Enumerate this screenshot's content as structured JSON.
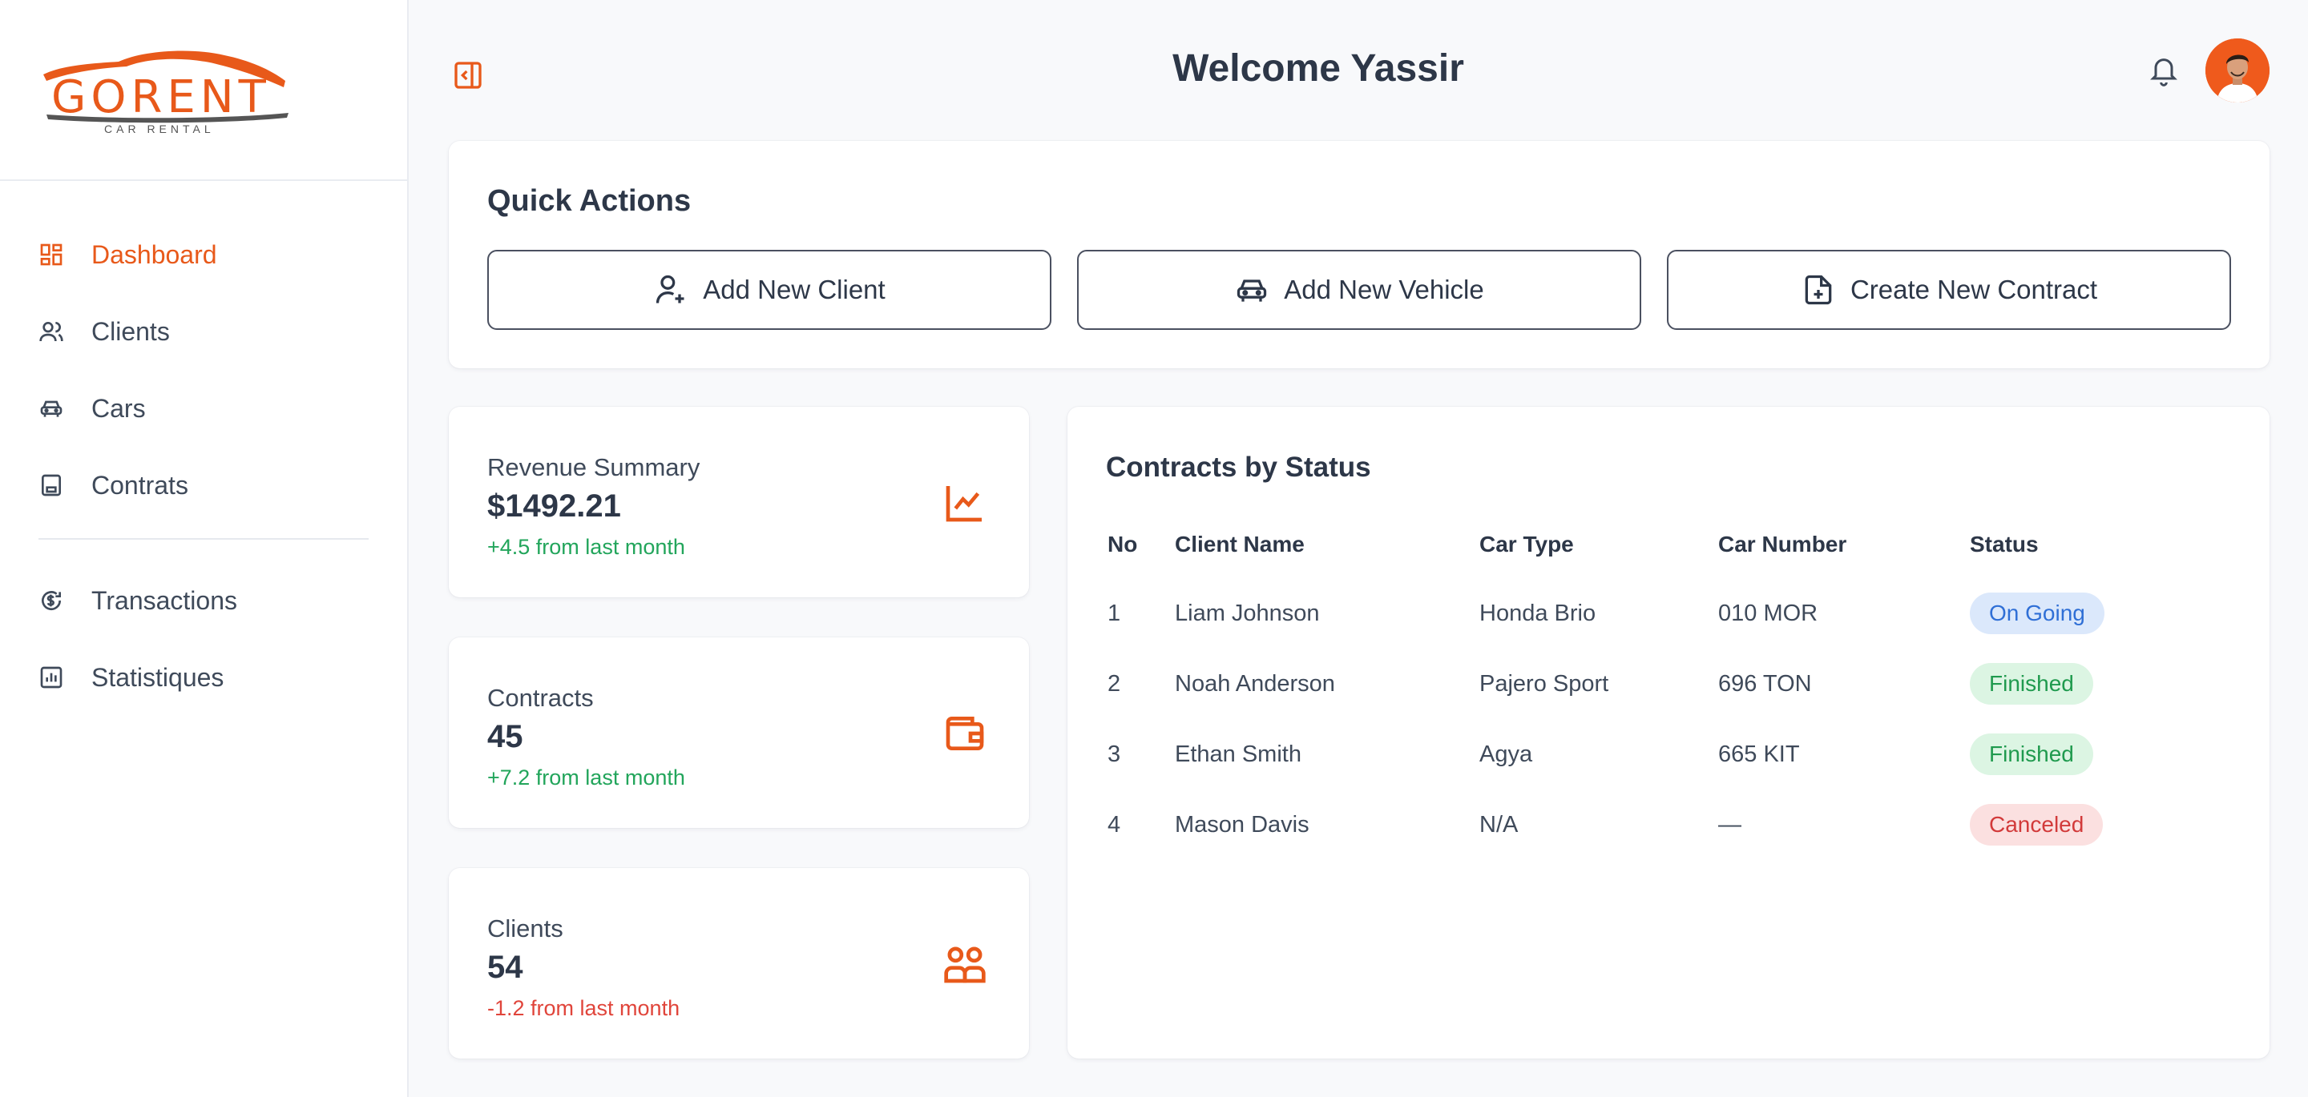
{
  "brand": {
    "name": "GORENT",
    "tagline": "CAR RENTAL"
  },
  "sidebar": {
    "items": [
      {
        "label": "Dashboard",
        "icon": "dashboard-icon",
        "active": true
      },
      {
        "label": "Clients",
        "icon": "users-icon",
        "active": false
      },
      {
        "label": "Cars",
        "icon": "car-icon",
        "active": false
      },
      {
        "label": "Contrats",
        "icon": "contract-icon",
        "active": false
      }
    ],
    "secondary": [
      {
        "label": "Transactions",
        "icon": "transactions-icon"
      },
      {
        "label": "Statistiques",
        "icon": "chart-bar-icon"
      }
    ]
  },
  "header": {
    "welcome": "Welcome Yassir"
  },
  "quick_actions": {
    "title": "Quick Actions",
    "buttons": [
      {
        "label": "Add New Client",
        "icon": "user-plus-icon"
      },
      {
        "label": "Add New Vehicle",
        "icon": "car-icon"
      },
      {
        "label": "Create New Contract",
        "icon": "file-plus-icon"
      }
    ]
  },
  "stats": [
    {
      "label": "Revenue Summary",
      "value": "$1492.21",
      "delta": "+4.5 from last month",
      "trend": "up",
      "icon": "trend-up-icon"
    },
    {
      "label": "Contracts",
      "value": "45",
      "delta": "+7.2 from last month",
      "trend": "up",
      "icon": "wallet-icon"
    },
    {
      "label": "Clients",
      "value": "54",
      "delta": "-1.2 from last month",
      "trend": "down",
      "icon": "group-icon"
    }
  ],
  "contracts_table": {
    "title": "Contracts by Status",
    "columns": [
      "No",
      "Client Name",
      "Car Type",
      "Car Number",
      "Status"
    ],
    "rows": [
      {
        "no": "1",
        "client": "Liam Johnson",
        "car_type": "Honda Brio",
        "car_number": "010 MOR",
        "status": "On Going"
      },
      {
        "no": "2",
        "client": "Noah Anderson",
        "car_type": "Pajero Sport",
        "car_number": "696 TON",
        "status": "Finished"
      },
      {
        "no": "3",
        "client": "Ethan Smith",
        "car_type": "Agya",
        "car_number": "665 KIT",
        "status": "Finished"
      },
      {
        "no": "4",
        "client": "Mason Davis",
        "car_type": "N/A",
        "car_number": "—",
        "status": "Canceled"
      }
    ]
  },
  "colors": {
    "accent": "#e8591a",
    "positive": "#22a55b",
    "negative": "#e0453b",
    "status_ongoing_bg": "#dbe8fb",
    "status_ongoing_fg": "#2f6fd6",
    "status_finished_bg": "#dcf5e3",
    "status_finished_fg": "#1f9a4e",
    "status_canceled_bg": "#fbe0e0",
    "status_canceled_fg": "#d23a3a"
  }
}
